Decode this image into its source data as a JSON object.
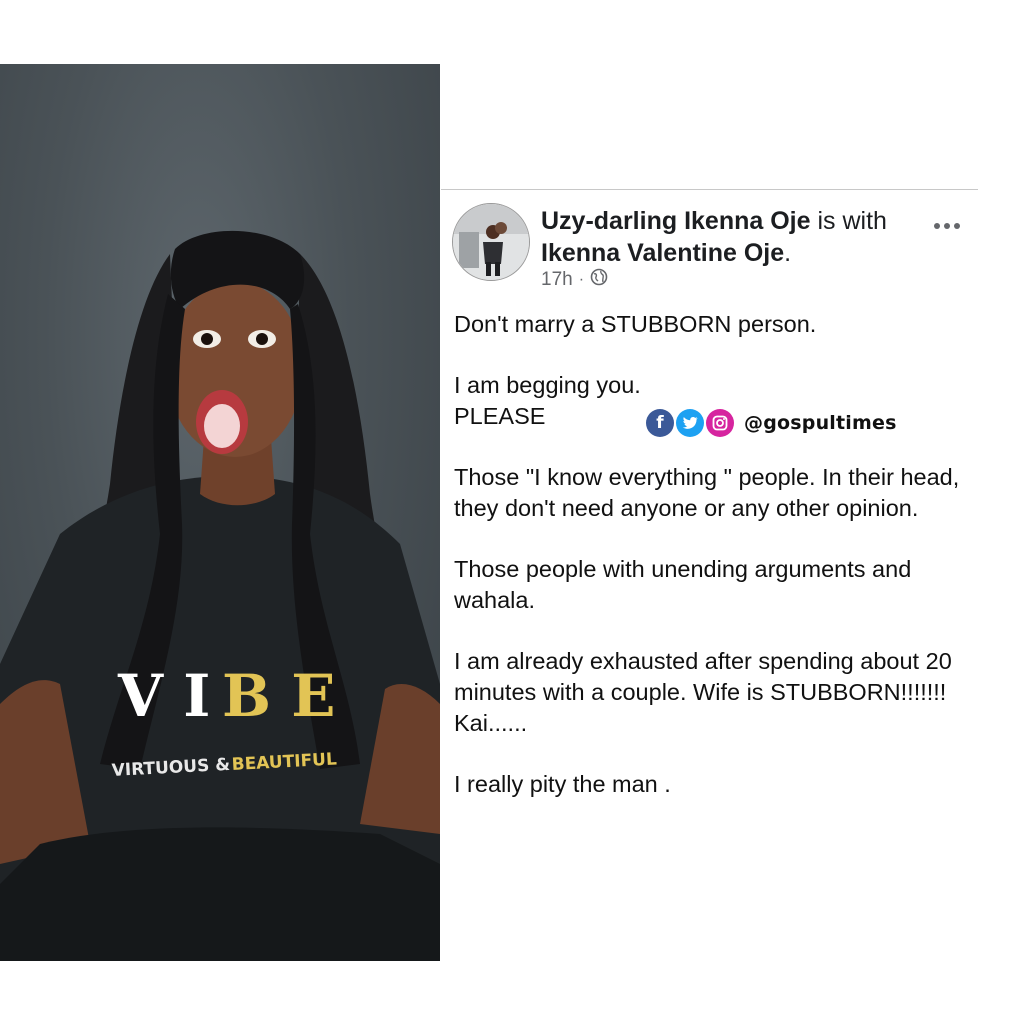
{
  "photo": {
    "shirt_brand": "VIBE",
    "shirt_tagline": "VIRTUOUS & BEAUTIFUL"
  },
  "post": {
    "author": "Uzy-darling Ikenna Oje",
    "with_text": " is with",
    "tagged": "Ikenna Valentine Oje",
    "tagged_suffix": ".",
    "time": "17h",
    "separator": "·",
    "privacy_icon": "globe-icon",
    "more_icon": "more-options-icon",
    "paragraphs": [
      "Don't marry a STUBBORN person.",
      "I am begging you.\nPLEASE",
      "Those \"I know everything \" people.  In their head, they don't need anyone or any other opinion.",
      "Those people with unending arguments and wahala.",
      "I am already exhausted after spending about 20 minutes with a couple.  Wife is STUBBORN!!!!!!! Kai......",
      "I really pity the man ."
    ]
  },
  "watermark": {
    "handle": "@gospultimes",
    "icons": [
      "facebook-icon",
      "twitter-icon",
      "instagram-icon"
    ],
    "colors": {
      "facebook": "#3b5998",
      "twitter": "#1da1f2",
      "instagram": "#d6249f"
    }
  }
}
